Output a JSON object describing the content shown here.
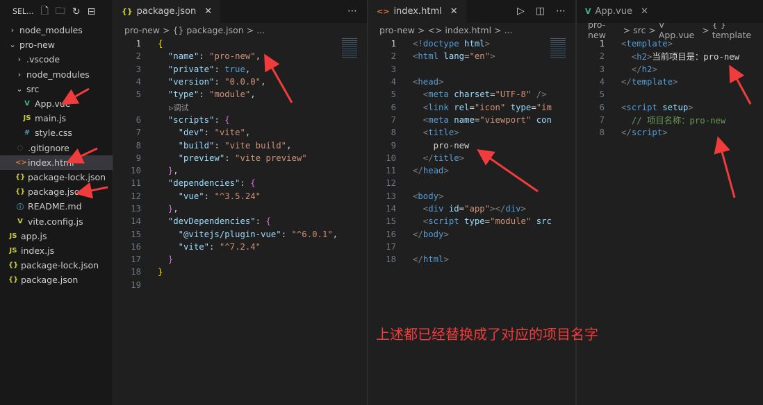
{
  "sidebar": {
    "title": "SEL...",
    "items": [
      {
        "label": "node_modules",
        "depth": 0,
        "chev": ">",
        "icon": ""
      },
      {
        "label": "pro-new",
        "depth": 0,
        "chev": "v",
        "icon": ""
      },
      {
        "label": ".vscode",
        "depth": 1,
        "chev": ">",
        "icon": ""
      },
      {
        "label": "node_modules",
        "depth": 1,
        "chev": ">",
        "icon": ""
      },
      {
        "label": "src",
        "depth": 1,
        "chev": "v",
        "icon": ""
      },
      {
        "label": "App.vue",
        "depth": 2,
        "chev": "",
        "icon": "V",
        "color": "#41b883"
      },
      {
        "label": "main.js",
        "depth": 2,
        "chev": "",
        "icon": "JS",
        "color": "#cbcb41"
      },
      {
        "label": "style.css",
        "depth": 2,
        "chev": "",
        "icon": "#",
        "color": "#519aba"
      },
      {
        "label": ".gitignore",
        "depth": 1,
        "chev": "",
        "icon": "◌",
        "color": "#6d8086"
      },
      {
        "label": "index.html",
        "depth": 1,
        "chev": "",
        "icon": "<>",
        "color": "#e37933",
        "selected": true
      },
      {
        "label": "package-lock.json",
        "depth": 1,
        "chev": "",
        "icon": "{}",
        "color": "#cbcb41"
      },
      {
        "label": "package.json",
        "depth": 1,
        "chev": "",
        "icon": "{}",
        "color": "#cbcb41"
      },
      {
        "label": "README.md",
        "depth": 1,
        "chev": "",
        "icon": "ⓘ",
        "color": "#519aba"
      },
      {
        "label": "vite.config.js",
        "depth": 1,
        "chev": "",
        "icon": "V",
        "color": "#cbcb41"
      },
      {
        "label": "app.js",
        "depth": 0,
        "chev": "",
        "icon": "JS",
        "color": "#cbcb41"
      },
      {
        "label": "index.js",
        "depth": 0,
        "chev": "",
        "icon": "JS",
        "color": "#cbcb41"
      },
      {
        "label": "package-lock.json",
        "depth": 0,
        "chev": "",
        "icon": "{}",
        "color": "#cbcb41"
      },
      {
        "label": "package.json",
        "depth": 0,
        "chev": "",
        "icon": "{}",
        "color": "#cbcb41"
      }
    ]
  },
  "editors": [
    {
      "tab": "package.json",
      "tab_icon": "{}",
      "tab_icon_color": "#cbcb41",
      "inactive": false,
      "crumbs": [
        "pro-new",
        ">",
        "{} package.json",
        ">",
        "..."
      ],
      "actions": [
        "⋯"
      ],
      "lens_after": 5,
      "lens": "▷调试",
      "lines": [
        [
          [
            "y",
            "{"
          ]
        ],
        [
          [
            "k",
            "  \"name\""
          ],
          [
            "w",
            ": "
          ],
          [
            "s",
            "\"pro-new\""
          ],
          [
            "w",
            ","
          ]
        ],
        [
          [
            "k",
            "  \"private\""
          ],
          [
            "w",
            ": "
          ],
          [
            "b",
            "true"
          ],
          [
            "w",
            ","
          ]
        ],
        [
          [
            "k",
            "  \"version\""
          ],
          [
            "w",
            ": "
          ],
          [
            "s",
            "\"0.0.0\""
          ],
          [
            "w",
            ","
          ]
        ],
        [
          [
            "k",
            "  \"type\""
          ],
          [
            "w",
            ": "
          ],
          [
            "s",
            "\"module\""
          ],
          [
            "w",
            ","
          ]
        ],
        [
          [
            "k",
            "  \"scripts\""
          ],
          [
            "w",
            ": "
          ],
          [
            "m",
            "{"
          ]
        ],
        [
          [
            "k",
            "    \"dev\""
          ],
          [
            "w",
            ": "
          ],
          [
            "s",
            "\"vite\""
          ],
          [
            "w",
            ","
          ]
        ],
        [
          [
            "k",
            "    \"build\""
          ],
          [
            "w",
            ": "
          ],
          [
            "s",
            "\"vite build\""
          ],
          [
            "w",
            ","
          ]
        ],
        [
          [
            "k",
            "    \"preview\""
          ],
          [
            "w",
            ": "
          ],
          [
            "s",
            "\"vite preview\""
          ]
        ],
        [
          [
            "m",
            "  }"
          ],
          [
            "w",
            ","
          ]
        ],
        [
          [
            "k",
            "  \"dependencies\""
          ],
          [
            "w",
            ": "
          ],
          [
            "m",
            "{"
          ]
        ],
        [
          [
            "k",
            "    \"vue\""
          ],
          [
            "w",
            ": "
          ],
          [
            "s",
            "\"^3.5.24\""
          ]
        ],
        [
          [
            "m",
            "  }"
          ],
          [
            "w",
            ","
          ]
        ],
        [
          [
            "k",
            "  \"devDependencies\""
          ],
          [
            "w",
            ": "
          ],
          [
            "m",
            "{"
          ]
        ],
        [
          [
            "k",
            "    \"@vitejs/plugin-vue\""
          ],
          [
            "w",
            ": "
          ],
          [
            "s",
            "\"^6.0.1\""
          ],
          [
            "w",
            ","
          ]
        ],
        [
          [
            "k",
            "    \"vite\""
          ],
          [
            "w",
            ": "
          ],
          [
            "s",
            "\"^7.2.4\""
          ]
        ],
        [
          [
            "m",
            "  }"
          ]
        ],
        [
          [
            "y",
            "}"
          ]
        ],
        []
      ]
    },
    {
      "tab": "index.html",
      "tab_icon": "<>",
      "tab_icon_color": "#e37933",
      "inactive": false,
      "crumbs": [
        "pro-new",
        ">",
        "<> index.html",
        ">",
        "..."
      ],
      "actions": [
        "▷",
        "◫",
        "⋯"
      ],
      "lines": [
        [
          [
            "g",
            "<!"
          ],
          [
            "b",
            "doctype"
          ],
          [
            "k",
            " html"
          ],
          [
            "g",
            ">"
          ]
        ],
        [
          [
            "g",
            "<"
          ],
          [
            "b",
            "html"
          ],
          [
            "k",
            " lang"
          ],
          [
            "w",
            "="
          ],
          [
            "s",
            "\"en\""
          ],
          [
            "g",
            ">"
          ]
        ],
        [],
        [
          [
            "g",
            "<"
          ],
          [
            "b",
            "head"
          ],
          [
            "g",
            ">"
          ]
        ],
        [
          [
            "g",
            "  <"
          ],
          [
            "b",
            "meta"
          ],
          [
            "k",
            " charset"
          ],
          [
            "w",
            "="
          ],
          [
            "s",
            "\"UTF-8\""
          ],
          [
            "g",
            " />"
          ]
        ],
        [
          [
            "g",
            "  <"
          ],
          [
            "b",
            "link"
          ],
          [
            "k",
            " rel"
          ],
          [
            "w",
            "="
          ],
          [
            "s",
            "\"icon\""
          ],
          [
            "k",
            " type"
          ],
          [
            "w",
            "="
          ],
          [
            "s",
            "\"im"
          ]
        ],
        [
          [
            "g",
            "  <"
          ],
          [
            "b",
            "meta"
          ],
          [
            "k",
            " name"
          ],
          [
            "w",
            "="
          ],
          [
            "s",
            "\"viewport\""
          ],
          [
            "k",
            " con"
          ]
        ],
        [
          [
            "g",
            "  <"
          ],
          [
            "b",
            "title"
          ],
          [
            "g",
            ">"
          ]
        ],
        [
          [
            "w",
            "    pro-new"
          ]
        ],
        [
          [
            "g",
            "  </"
          ],
          [
            "b",
            "title"
          ],
          [
            "g",
            ">"
          ]
        ],
        [
          [
            "g",
            "</"
          ],
          [
            "b",
            "head"
          ],
          [
            "g",
            ">"
          ]
        ],
        [],
        [
          [
            "g",
            "<"
          ],
          [
            "b",
            "body"
          ],
          [
            "g",
            ">"
          ]
        ],
        [
          [
            "g",
            "  <"
          ],
          [
            "b",
            "div"
          ],
          [
            "k",
            " id"
          ],
          [
            "w",
            "="
          ],
          [
            "s",
            "\"app\""
          ],
          [
            "g",
            "></"
          ],
          [
            "b",
            "div"
          ],
          [
            "g",
            ">"
          ]
        ],
        [
          [
            "g",
            "  <"
          ],
          [
            "b",
            "script"
          ],
          [
            "k",
            " type"
          ],
          [
            "w",
            "="
          ],
          [
            "s",
            "\"module\""
          ],
          [
            "k",
            " src"
          ]
        ],
        [
          [
            "g",
            "</"
          ],
          [
            "b",
            "body"
          ],
          [
            "g",
            ">"
          ]
        ],
        [],
        [
          [
            "g",
            "</"
          ],
          [
            "b",
            "html"
          ],
          [
            "g",
            ">"
          ]
        ]
      ]
    },
    {
      "tab": "App.vue",
      "tab_icon": "V",
      "tab_icon_color": "#41b883",
      "inactive": true,
      "crumbs": [
        "pro-new",
        ">",
        "src",
        ">",
        "V App.vue",
        ">",
        "{ } template"
      ],
      "actions": [],
      "lines": [
        [
          [
            "g",
            "<"
          ],
          [
            "b",
            "template"
          ],
          [
            "g",
            ">"
          ]
        ],
        [
          [
            "g",
            "  <"
          ],
          [
            "b",
            "h2"
          ],
          [
            "g",
            ">"
          ],
          [
            "w",
            "当前项目是："
          ],
          [
            "w",
            "pro-new"
          ]
        ],
        [
          [
            "g",
            "  </"
          ],
          [
            "b",
            "h2"
          ],
          [
            "g",
            ">"
          ]
        ],
        [
          [
            "g",
            "</"
          ],
          [
            "b",
            "template"
          ],
          [
            "g",
            ">"
          ]
        ],
        [],
        [
          [
            "g",
            "<"
          ],
          [
            "b",
            "script"
          ],
          [
            "k",
            " setup"
          ],
          [
            "g",
            ">"
          ]
        ],
        [
          [
            "c",
            "  // 项目名称：pro-new"
          ]
        ],
        [
          [
            "g",
            "</"
          ],
          [
            "b",
            "script"
          ],
          [
            "g",
            ">"
          ]
        ]
      ]
    }
  ],
  "annotation": "上述都已经替换成了对应的项目名字",
  "colors": {
    "arrow": "#f03c3c"
  }
}
